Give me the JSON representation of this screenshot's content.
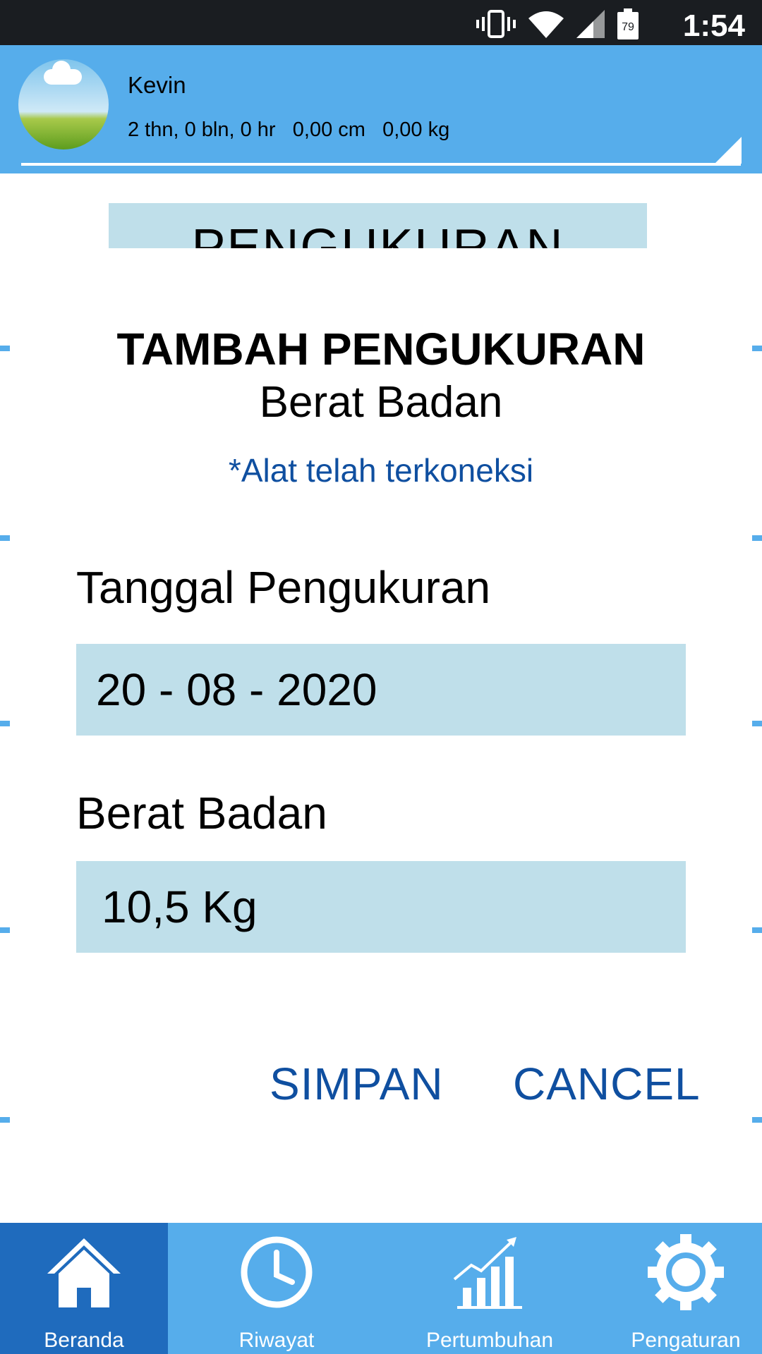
{
  "status_bar": {
    "time": "1:54",
    "battery": "79",
    "icons": [
      "vibrate-icon",
      "wifi-icon",
      "signal-icon",
      "battery-icon"
    ]
  },
  "profile": {
    "name": "Kevin",
    "age": "2 thn, 0 bln, 0 hr",
    "height": "0,00 cm",
    "weight": "0,00 kg"
  },
  "background": {
    "card_title": "PENGUKURAN"
  },
  "dialog": {
    "title": "TAMBAH PENGUKURAN",
    "subtitle": "Berat Badan",
    "note": "*Alat telah terkoneksi",
    "date_label": "Tanggal Pengukuran",
    "date_value": "20 - 08 - 2020",
    "weight_label": "Berat Badan",
    "weight_value": "10,5 Kg",
    "save_label": "SIMPAN",
    "cancel_label": "CANCEL"
  },
  "nav": {
    "items": [
      {
        "label": "Beranda",
        "icon": "home-icon",
        "active": true
      },
      {
        "label": "Riwayat",
        "icon": "clock-icon",
        "active": false
      },
      {
        "label": "Pertumbuhan",
        "icon": "growth-chart-icon",
        "active": false
      },
      {
        "label": "Pengaturan",
        "icon": "gear-icon",
        "active": false
      }
    ]
  },
  "colors": {
    "primary": "#56adeb",
    "nav_active": "#1f6bbd",
    "field_bg": "#bfdfea",
    "action_text": "#0f4fa0",
    "status_bar": "#1a1d21"
  }
}
